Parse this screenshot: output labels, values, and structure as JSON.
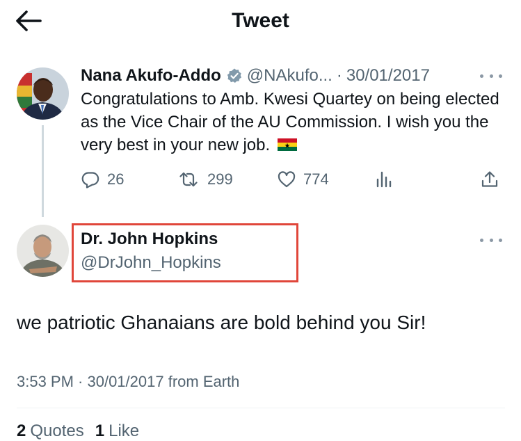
{
  "header": {
    "title": "Tweet",
    "back_icon": "arrow-left-icon"
  },
  "parent_tweet": {
    "author_name": "Nana Akufo-Addo",
    "verified": true,
    "handle": "@NAkufo...",
    "separator": "·",
    "date": "30/01/2017",
    "text": "Congratulations to Amb. Kwesi Quartey on being elected as the Vice Chair of the AU Commission. I wish you the very best in your new job.",
    "emoji_icon": "ghana-flag-icon",
    "stats": {
      "replies": "26",
      "retweets": "299",
      "likes": "774"
    }
  },
  "reply_tweet": {
    "author_name": "Dr. John Hopkins",
    "handle": "@DrJohn_Hopkins",
    "text": "we patriotic Ghanaians are bold behind you Sir!",
    "meta": "3:53 PM · 30/01/2017 from Earth",
    "quotes_count": "2",
    "quotes_label": "Quotes",
    "likes_count": "1",
    "likes_label": "Like"
  },
  "colors": {
    "text": "#0f1419",
    "secondary": "#536471",
    "verified": "#829aab",
    "highlight": "#e0463a"
  }
}
